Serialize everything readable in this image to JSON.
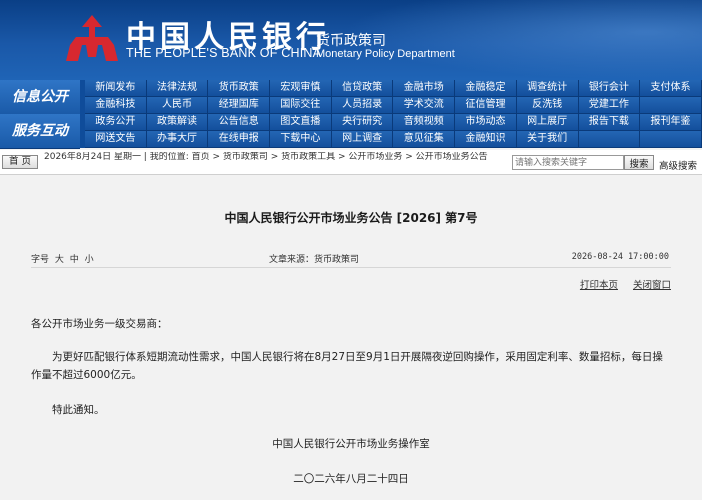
{
  "header": {
    "title_zh": "中国人民银行",
    "title_en": "THE PEOPLE'S BANK OF CHINA",
    "dept_zh": "货币政策司",
    "dept_en": "Monetary Policy Department",
    "icon": "pboc-logo-icon",
    "colors": {
      "header_bg": "#1a58a8",
      "logo_red": "#d7282f",
      "nav_bg": "#0f4c9a"
    }
  },
  "nav": {
    "label1": "信息公开",
    "label2": "服务互动",
    "row1": [
      "新闻发布",
      "法律法规",
      "货币政策",
      "宏观审慎",
      "信贷政策",
      "金融市场",
      "金融稳定",
      "调查统计",
      "银行会计",
      "支付体系"
    ],
    "row2": [
      "金融科技",
      "人民币",
      "经理国库",
      "国际交往",
      "人员招录",
      "学术交流",
      "征信管理",
      "反洗钱",
      "党建工作",
      ""
    ],
    "row3": [
      "政务公开",
      "政策解读",
      "公告信息",
      "图文直播",
      "央行研究",
      "音频视频",
      "市场动态",
      "网上展厅",
      "报告下载",
      "报刊年鉴"
    ],
    "row4": [
      "网送文告",
      "办事大厅",
      "在线申报",
      "下载中心",
      "网上调查",
      "意见征集",
      "金融知识",
      "关于我们",
      "",
      ""
    ]
  },
  "breadcrumb": {
    "home": "首 页",
    "text": "2026年8月24日 星期一 | 我的位置: 首页 > 货币政策司 > 货币政策工具 > 公开市场业务 > 公开市场业务公告",
    "search_placeholder": "请输入搜索关键字",
    "search_btn": "搜索",
    "advanced": "高级搜索"
  },
  "article": {
    "title": "中国人民银行公开市场业务公告 [2026] 第7号",
    "font_label": "字号",
    "font_large": "大",
    "font_medium": "中",
    "font_small": "小",
    "source": "文章来源：货币政策司",
    "time": "2026-08-24  17:00:00",
    "print": "打印本页",
    "close": "关闭窗口",
    "salutation": "各公开市场业务一级交易商：",
    "body": "为更好匹配银行体系短期流动性需求，中国人民银行将在8月27日至9月1日开展隔夜逆回购操作，采用固定利率、数量招标，每日操作量不超过6000亿元。",
    "closing": "特此通知。",
    "signature": "中国人民银行公开市场业务操作室",
    "date": "二〇二六年八月二十四日"
  }
}
